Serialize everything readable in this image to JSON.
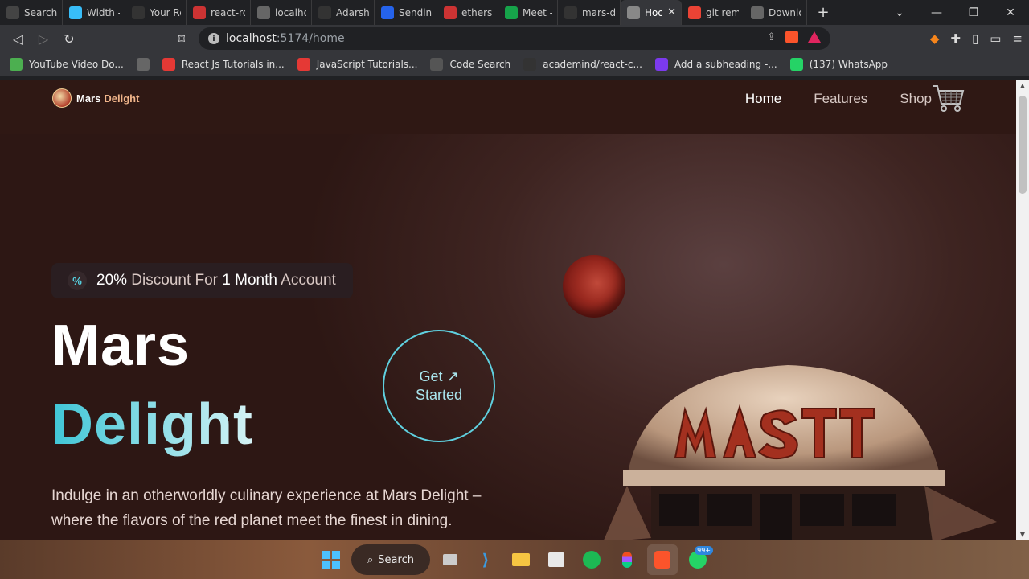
{
  "browser": {
    "tabs": [
      {
        "label": "Search",
        "icon_color": "#444"
      },
      {
        "label": "Width -",
        "icon_color": "#38bdf8"
      },
      {
        "label": "Your Re",
        "icon_color": "#333"
      },
      {
        "label": "react-ro",
        "icon_color": "#cc3333"
      },
      {
        "label": "localhos",
        "icon_color": "#666"
      },
      {
        "label": "AdarshC",
        "icon_color": "#333"
      },
      {
        "label": "Sending",
        "icon_color": "#2563eb"
      },
      {
        "label": "ethers -",
        "icon_color": "#cc3333"
      },
      {
        "label": "Meet -",
        "icon_color": "#16a34a"
      },
      {
        "label": "mars-de",
        "icon_color": "#333"
      },
      {
        "label": "Hoo",
        "icon_color": "#888",
        "active": true
      },
      {
        "label": "git rem",
        "icon_color": "#ea4335"
      },
      {
        "label": "Downlo",
        "icon_color": "#666"
      }
    ],
    "close_tab": "✕",
    "new_tab": "+",
    "address": {
      "host": "localhost",
      "path": ":5174/home"
    },
    "bookmarks": [
      {
        "label": "YouTube Video Do...",
        "icon_color": "#4caf50"
      },
      {
        "label": "",
        "icon_color": "#666"
      },
      {
        "label": "React Js Tutorials in...",
        "icon_color": "#e53935"
      },
      {
        "label": "JavaScript Tutorials...",
        "icon_color": "#e53935"
      },
      {
        "label": "Code Search",
        "icon_color": "#555"
      },
      {
        "label": "academind/react-c...",
        "icon_color": "#333"
      },
      {
        "label": "Add a subheading -...",
        "icon_color": "#7c3aed"
      },
      {
        "label": "(137) WhatsApp",
        "icon_color": "#25d366"
      }
    ]
  },
  "site": {
    "logo": {
      "part1": "Mars",
      "part2": "Delight"
    },
    "menu": [
      {
        "label": "Home",
        "active": true
      },
      {
        "label": "Features",
        "active": false
      },
      {
        "label": "Shop",
        "active": false
      }
    ],
    "badge": {
      "icon": "%",
      "pct": "20%",
      "mid": " Discount For ",
      "dur": "1 Month",
      "tail": " Account"
    },
    "headline_1": "Mars",
    "headline_2": "Delight",
    "cta_line1": "Get ↗",
    "cta_line2": "Started",
    "description": "Indulge in an otherworldly culinary experience at Mars Delight – where the flavors of the red planet meet the finest in dining."
  },
  "taskbar": {
    "search_label": "Search",
    "whatsapp_badge": "99+"
  },
  "colors": {
    "accent": "#5fd0df",
    "page_bg": "#3e2421"
  }
}
